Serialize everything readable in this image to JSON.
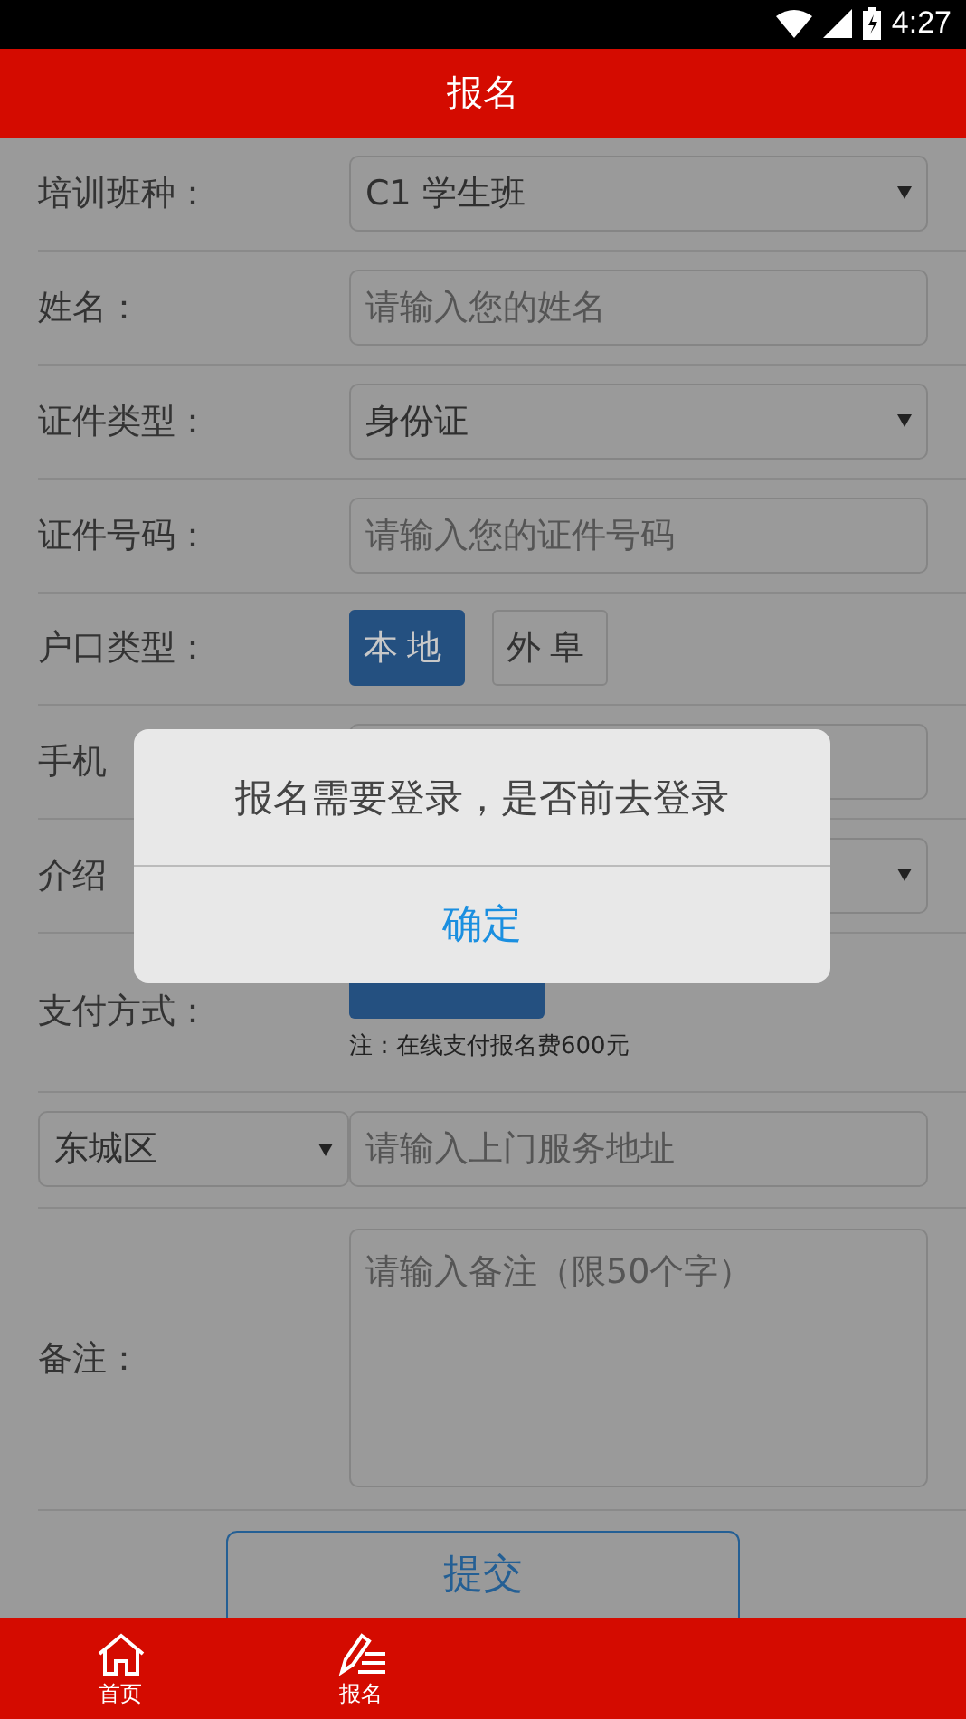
{
  "status_bar": {
    "time": "4:27"
  },
  "header": {
    "title": "报名"
  },
  "form": {
    "rows": [
      {
        "kind": "select",
        "label": "培训班种：",
        "value": "C1 学生班"
      },
      {
        "kind": "input",
        "label": "姓名：",
        "placeholder": "请输入您的姓名"
      },
      {
        "kind": "select",
        "label": "证件类型：",
        "value": "身份证"
      },
      {
        "kind": "input",
        "label": "证件号码：",
        "placeholder": "请输入您的证件号码"
      },
      {
        "kind": "toggle",
        "label": "户口类型：",
        "options": [
          {
            "label": "本地",
            "selected": true
          },
          {
            "label": "外阜",
            "selected": false
          }
        ]
      },
      {
        "kind": "input",
        "label": "手机"
      },
      {
        "kind": "select",
        "label": "介绍"
      },
      {
        "kind": "payment",
        "label": "支付方式：",
        "note": "注：在线支付报名费600元"
      },
      {
        "kind": "address",
        "district": "东城区",
        "placeholder": "请输入上门服务地址"
      },
      {
        "kind": "textarea",
        "label": "备注：",
        "placeholder": "请输入备注（限50个字）"
      }
    ]
  },
  "submit_button": "提交",
  "dialog": {
    "message": "报名需要登录，是否前去登录",
    "button": "确定"
  },
  "bottom_nav": [
    {
      "kind": "home",
      "label": "首页"
    },
    {
      "kind": "pencil",
      "label": "报名"
    }
  ]
}
